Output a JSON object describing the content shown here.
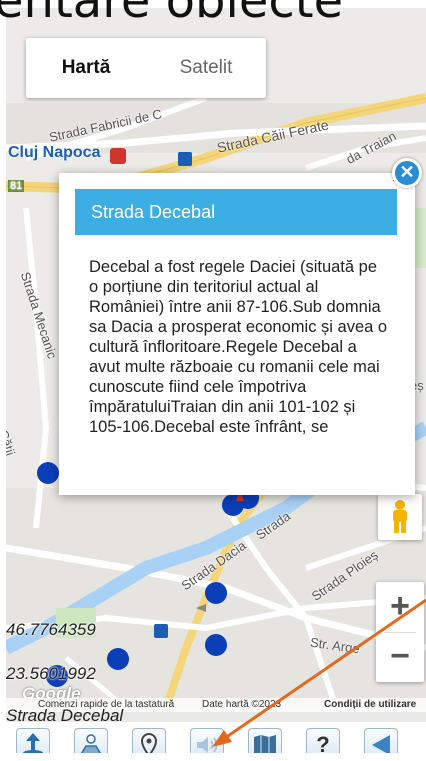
{
  "heading_crop": "entare obiecte",
  "map_type": {
    "map_label": "Hartă",
    "satellite_label": "Satelit"
  },
  "map_labels": {
    "strada_fabricii": "Strada Fabricii de C",
    "strada_caii_ferate": "Strada Căii Ferate",
    "cluj_napoca": "Cluj Napoca",
    "traian": "da Traian",
    "mecanic": "Strada Mecanic",
    "strada_dacia": "Strada Dacia",
    "strada_ploiesti": "Strada Ploieș",
    "str_arge": "Str. Arge",
    "strada": "Strada",
    "catii": "Cătii",
    "number_81": "81",
    "edge_es": "eș"
  },
  "popup": {
    "title": "Strada Decebal",
    "body": "Decebal a fost regele Daciei (situată pe o porțiune din teritoriul actual al României) între anii 87-106.Sub domnia sa Dacia a prosperat economic și avea o cultură înfloritoare.Regele Decebal a avut multe războaie cu romanii cele mai cunoscute fiind cele împotriva împăratuluiTraian din anii 101-102 și 105-106.Decebal este înfrânt, se",
    "close_glyph": "×"
  },
  "coordinates": {
    "lat": "46.7764359",
    "lon": "23.5601992"
  },
  "attribution": {
    "shortcuts": "Comenzi rapide de la tastatură",
    "map_data": "Date hartă ©2023",
    "terms": "Condiții de utilizare"
  },
  "google_logo": "Google",
  "current_street": "Strada Decebal",
  "zoom": {
    "in": "+",
    "out": "−"
  },
  "toolbar": {
    "help_glyph": "?",
    "icons": [
      "upload-pin-icon",
      "person-map-icon",
      "location-pin-icon",
      "speaker-icon",
      "map-book-icon",
      "help-icon",
      "back-icon"
    ]
  },
  "colors": {
    "popup_header": "#3daee3",
    "marker": "#0a3fb8",
    "river": "#a9d1f5",
    "arrow": "#e06a20",
    "highway": "#f4d57a"
  }
}
